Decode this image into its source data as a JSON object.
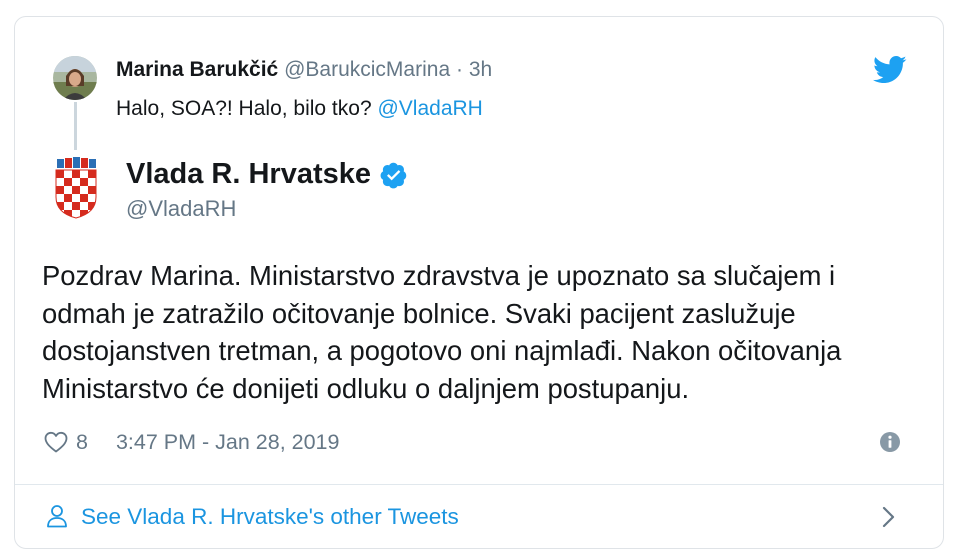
{
  "parent_tweet": {
    "author_name": "Marina Barukčić",
    "handle": "@BarukcicMarina",
    "separator": "·",
    "time_ago": "3h",
    "text_prefix": "Halo, SOA?! Halo, bilo tko?",
    "mention": "@VladaRH"
  },
  "main_tweet": {
    "author_name": "Vlada R. Hrvatske",
    "handle": "@VladaRH",
    "text": "Pozdrav Marina. Ministarstvo zdravstva je upoznato sa slučajem i odmah je zatražilo očitovanje bolnice. Svaki pacijent zaslužuje dostojanstven tretman, a pogotovo oni najmlađi. Nakon očitovanja Ministarstvo će donijeti odluku o daljnjem postupanju.",
    "like_count": "8",
    "timestamp": "3:47 PM - Jan 28, 2019"
  },
  "footer": {
    "label": "See Vlada R. Hrvatske's other Tweets"
  },
  "icons": {
    "bird": "twitter-bird-icon",
    "verified": "verified-badge-icon",
    "heart": "heart-icon",
    "info": "info-icon",
    "person": "person-icon",
    "chevron": "chevron-right-icon"
  },
  "colors": {
    "accent": "#1b95e0",
    "text": "#14171a",
    "muted": "#657786",
    "border": "#dfe3e7"
  }
}
